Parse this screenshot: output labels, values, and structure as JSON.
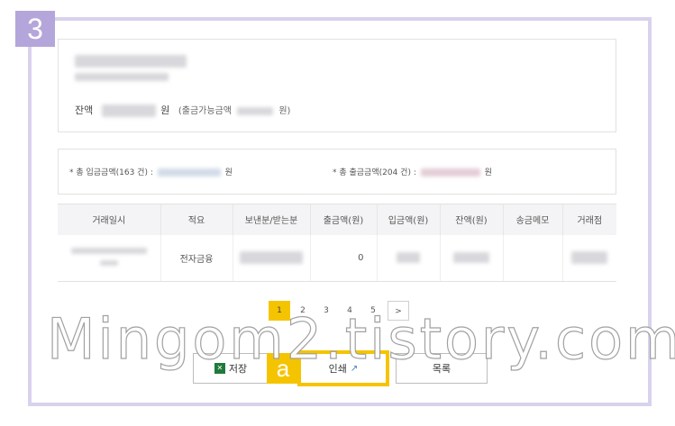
{
  "step": {
    "number": "3",
    "label": "a"
  },
  "account": {
    "balance_label": "잔액",
    "balance_unit": "원",
    "withdrawable_note_prefix": "(출금가능금액",
    "withdrawable_note_suffix": "원)"
  },
  "summary": {
    "deposit_label": "* 총 입금금액(163 건) :",
    "deposit_unit": "원",
    "withdraw_label": "* 총 출금금액(204 건) :",
    "withdraw_unit": "원"
  },
  "table": {
    "headers": [
      "거래일시",
      "적요",
      "보낸분/받는분",
      "출금액(원)",
      "입금액(원)",
      "잔액(원)",
      "송금메모",
      "거래점"
    ],
    "rows": [
      {
        "summary": "전자금융",
        "withdrawal": "0"
      }
    ]
  },
  "pagination": {
    "pages": [
      "1",
      "2",
      "3",
      "4",
      "5"
    ],
    "next": ">",
    "current": "1"
  },
  "buttons": {
    "save": "저장",
    "print": "인쇄",
    "list": "목록"
  },
  "icons": {
    "save": "excel-icon",
    "print": "external-link-icon"
  },
  "watermark": "Mingom2.tistory.com",
  "colors": {
    "accent": "#f5c400",
    "frame": "#d9d2ec",
    "badge": "#b4a6da"
  }
}
